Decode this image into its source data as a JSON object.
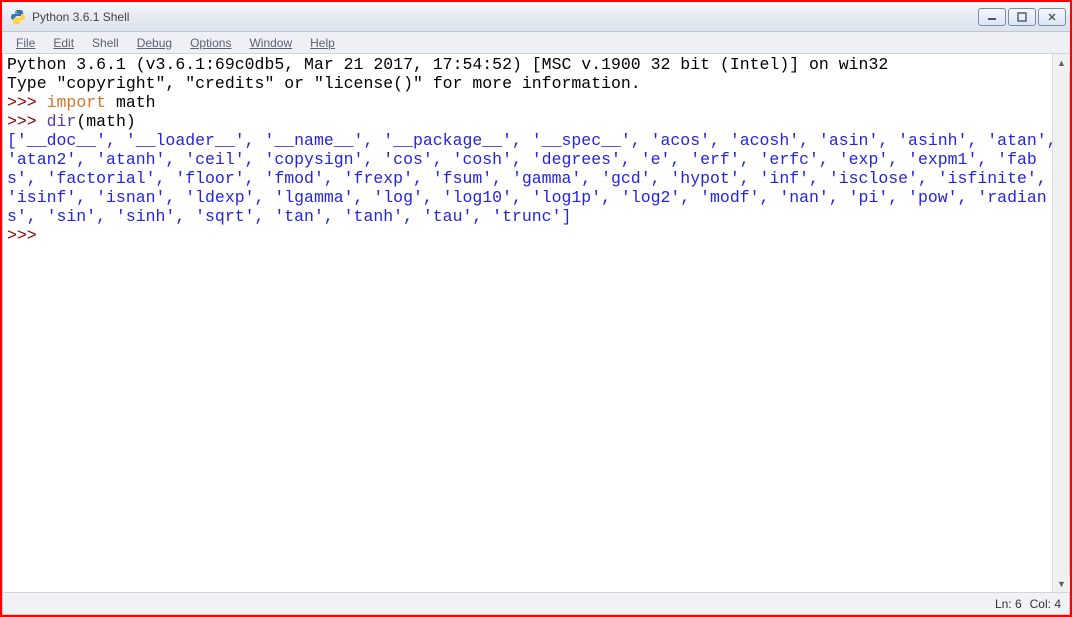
{
  "window": {
    "title": "Python 3.6.1 Shell"
  },
  "menu": {
    "file": "File",
    "edit": "Edit",
    "shell": "Shell",
    "debug": "Debug",
    "options": "Options",
    "window": "Window",
    "help": "Help"
  },
  "shell": {
    "banner_line1": "Python 3.6.1 (v3.6.1:69c0db5, Mar 21 2017, 17:54:52) [MSC v.1900 32 bit (Intel)] on win32",
    "banner_line2": "Type \"copyright\", \"credits\" or \"license()\" for more information.",
    "prompt": ">>>",
    "space": " ",
    "kw_import": "import",
    "mod_math": " math",
    "fn_dir": "dir",
    "call_arg": "(math)",
    "dir_output": "['__doc__', '__loader__', '__name__', '__package__', '__spec__', 'acos', 'acosh', 'asin', 'asinh', 'atan', 'atan2', 'atanh', 'ceil', 'copysign', 'cos', 'cosh', 'degrees', 'e', 'erf', 'erfc', 'exp', 'expm1', 'fabs', 'factorial', 'floor', 'fmod', 'frexp', 'fsum', 'gamma', 'gcd', 'hypot', 'inf', 'isclose', 'isfinite', 'isinf', 'isnan', 'ldexp', 'lgamma', 'log', 'log10', 'log1p', 'log2', 'modf', 'nan', 'pi', 'pow', 'radians', 'sin', 'sinh', 'sqrt', 'tan', 'tanh', 'tau', 'trunc']"
  },
  "status": {
    "line": "Ln: 6",
    "col": "Col: 4"
  }
}
